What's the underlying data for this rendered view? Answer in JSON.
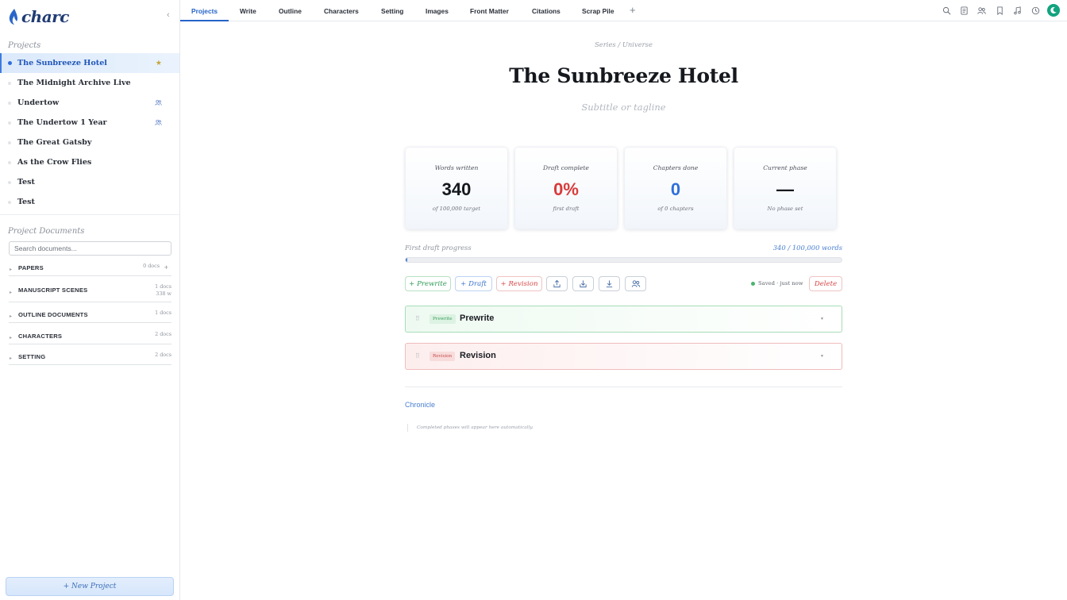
{
  "app": {
    "name": "charc"
  },
  "sidebar": {
    "collapse_glyph": "‹",
    "projects_label": "Projects",
    "projects": [
      {
        "name": "The Sunbreeze Hotel",
        "active": true,
        "badge": "★"
      },
      {
        "name": "The Midnight Archive Live"
      },
      {
        "name": "Undertow",
        "shared": true
      },
      {
        "name": "The Undertow 1 Year",
        "shared": true
      },
      {
        "name": "The Great Gatsby"
      },
      {
        "name": "As the Crow Flies"
      },
      {
        "name": "Test"
      },
      {
        "name": "Test"
      }
    ],
    "documents_label": "Project Documents",
    "search_placeholder": "Search documents...",
    "doc_groups": [
      {
        "name": "PAPERS",
        "count": "0 docs",
        "add": "+"
      },
      {
        "name": "MANUSCRIPT SCENES",
        "count": "1 docs",
        "words": "338 w"
      },
      {
        "name": "OUTLINE DOCUMENTS",
        "count": "1 docs"
      },
      {
        "name": "CHARACTERS",
        "count": "2 docs"
      },
      {
        "name": "SETTING",
        "count": "2 docs"
      }
    ],
    "new_project_label": "+ New Project"
  },
  "tabs": [
    {
      "label": "Projects",
      "active": true
    },
    {
      "label": "Write"
    },
    {
      "label": "Outline"
    },
    {
      "label": "Characters"
    },
    {
      "label": "Setting"
    },
    {
      "label": "Images"
    },
    {
      "label": "Front Matter"
    },
    {
      "label": "Citations"
    },
    {
      "label": "Scrap Pile"
    }
  ],
  "tab_add": "+",
  "toolbar_icons": [
    "search-icon",
    "document-icon",
    "people-icon",
    "bookmark-icon",
    "music-icon",
    "history-icon"
  ],
  "main": {
    "series_placeholder": "Series / Universe",
    "title": "The Sunbreeze Hotel",
    "subtitle_placeholder": "Subtitle or tagline",
    "stats": [
      {
        "label": "Words written",
        "value": "340",
        "sub": "of 100,000 target",
        "color": "#15181d"
      },
      {
        "label": "Draft complete",
        "value": "0%",
        "sub": "first draft",
        "color": "#d93a3a"
      },
      {
        "label": "Chapters done",
        "value": "0",
        "sub": "of 0 chapters",
        "color": "#2f6fdb"
      },
      {
        "label": "Current phase",
        "value": "—",
        "sub": "No phase set",
        "color": "#15181d"
      }
    ],
    "progress": {
      "label": "First draft progress",
      "count_text": "340 / 100,000 words",
      "current": 340,
      "target": 100000
    },
    "actions": {
      "prewrite": "+ Prewrite",
      "draft": "+ Draft",
      "revision": "+ Revision",
      "saved": "Saved · just now",
      "delete": "Delete"
    },
    "phases": [
      {
        "tag": "Prewrite",
        "name": "Prewrite",
        "caret": "▼"
      },
      {
        "tag": "Revision",
        "name": "Revision",
        "caret": "▼"
      }
    ],
    "chronicle_label": "Chronicle",
    "chronicle_empty": "Completed phases will appear here automatically."
  },
  "colors": {
    "accent": "#2563c9",
    "avatar": "#13a37f",
    "prewrite": "#2e9a55",
    "revision": "#d64545"
  }
}
